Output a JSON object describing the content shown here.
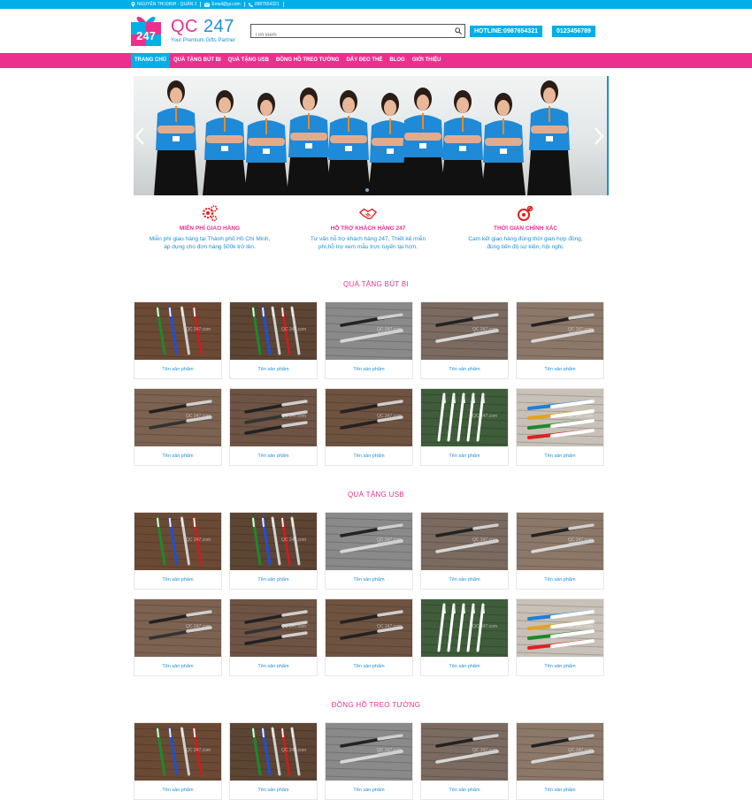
{
  "topbar": {
    "address": "NGUYỄN THỊ ĐỊNH - QUẬN 2",
    "email": "Email@gi.com",
    "phone": "0987654321"
  },
  "logo": {
    "badge": "247",
    "title_prefix": "QC",
    "title_suffix": " 247",
    "subtitle": "Your Premium Gifts Partner"
  },
  "search": {
    "placeholder": "Tìm kiếm"
  },
  "hotline": {
    "label": "HOTLINE:0987654321",
    "second": "0123456789"
  },
  "nav": {
    "items": [
      "TRANG CHỦ",
      "QUÀ TẶNG BÚT BI",
      "QUÀ TẶNG USB",
      "ĐỒNG HỒ TREO TƯỜNG",
      "DÂY ĐEO THẺ",
      "BLOG",
      "GIỚI THIỆU"
    ]
  },
  "features": [
    {
      "icon": "gears-icon",
      "title": "MIỄN PHÍ GIAO HÀNG",
      "line1": "Miễn phí giao hàng tại Thành phố Hồ Chí Minh,",
      "line2": "áp dụng cho đơn hàng 500k trở lên."
    },
    {
      "icon": "handshake-icon",
      "title": "HỖ TRỢ KHÁCH HÀNG 247",
      "line1": "Tư vấn hỗ trợ khách hàng 247, Thiết kế miễn",
      "line2": "phí,hỗ trợ xem mẫu trực tuyến tại hcm."
    },
    {
      "icon": "target-search-icon",
      "title": "THỜI GIAN CHÍNH XÁC",
      "line1": "Cam kết giao hàng đúng thời gian hợp đồng,",
      "line2": "đúng tiến độ sự kiện, hội nghị."
    }
  ],
  "sections": [
    {
      "title": "QUÀ TẶNG BÚT BI"
    },
    {
      "title": "QUÀ TẶNG USB"
    },
    {
      "title": "ĐỒNG HỒ TREO TƯỜNG"
    }
  ],
  "product": {
    "name": "Tên sản phẩm",
    "watermark": "QC 247.com"
  },
  "colors": {
    "blue": "#00aee8",
    "pink": "#ec2f8e",
    "link": "#1c8fd8"
  }
}
